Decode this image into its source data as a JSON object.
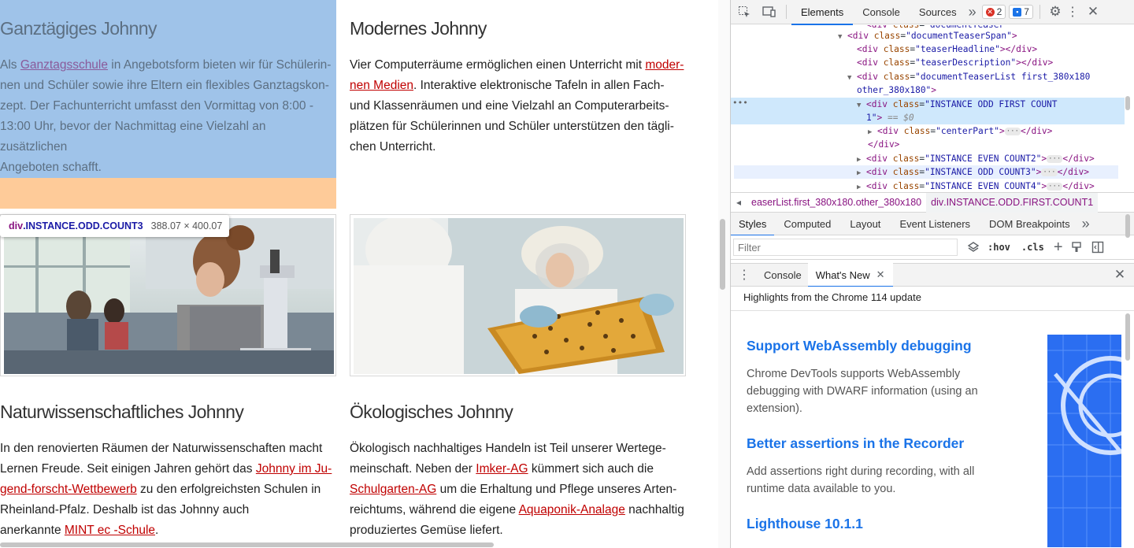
{
  "page": {
    "teasers": [
      {
        "headline": "Ganztägiges Johnny",
        "parts": [
          {
            "t": "Als "
          },
          {
            "a": "Ganztagsschule"
          },
          {
            "t": " in Angebotsform bieten wir für Schülerin-"
          },
          {
            "br": 1
          },
          {
            "t": "nen und Schüler sowie ihre Eltern ein flexibles Ganztagskon-"
          },
          {
            "br": 1
          },
          {
            "t": "zept. Der Fachunterricht umfasst den Vormittag von 8:00 -"
          },
          {
            "br": 1
          },
          {
            "t": "13:00 Uhr, bevor der Nachmittag eine Vielzahl an zusätzlichen"
          },
          {
            "br": 1
          },
          {
            "t": "Angeboten schafft."
          }
        ]
      },
      {
        "headline": "Modernes Johnny",
        "parts": [
          {
            "t": "Vier Computerräume ermöglichen einen Unterricht mit "
          },
          {
            "a": "moder-"
          },
          {
            "br": 1
          },
          {
            "a": "nen Medien"
          },
          {
            "t": ". Interaktive elektronische Tafeln in allen Fach-"
          },
          {
            "br": 1
          },
          {
            "t": "und Klassenräumen und eine Vielzahl an Computerarbeits-"
          },
          {
            "br": 1
          },
          {
            "t": "plätzen für Schülerinnen und Schüler unterstützen den tägli-"
          },
          {
            "br": 1
          },
          {
            "t": "chen Unterricht."
          }
        ]
      },
      {
        "headline": "Naturwissenschaftliches Johnny",
        "parts": [
          {
            "t": "In den renovierten Räumen der Naturwissenschaften macht"
          },
          {
            "br": 1
          },
          {
            "t": "Lernen Freude. Seit einigen Jahren gehört das "
          },
          {
            "a": "Johnny im Ju-"
          },
          {
            "br": 1
          },
          {
            "a": "gend-forscht-Wettbewerb"
          },
          {
            "t": " zu den erfolgreichsten Schulen in"
          },
          {
            "br": 1
          },
          {
            "t": "Rheinland-Pfalz. Deshalb ist das Johnny auch"
          },
          {
            "br": 1
          },
          {
            "t": "anerkannte "
          },
          {
            "a": "MINT ec -Schule"
          },
          {
            "t": "."
          }
        ]
      },
      {
        "headline": "Ökologisches Johnny",
        "parts": [
          {
            "t": "Ökologisch nachhaltiges Handeln ist Teil unserer Wertege-"
          },
          {
            "br": 1
          },
          {
            "t": "meinschaft. Neben der "
          },
          {
            "a": "Imker-AG"
          },
          {
            "t": " kümmert sich auch die"
          },
          {
            "br": 1
          },
          {
            "a": "Schulgarten-AG"
          },
          {
            "t": " um die Erhaltung und Pflege unseres Arten-"
          },
          {
            "br": 1
          },
          {
            "t": "reichtums, während die eigene "
          },
          {
            "a": "Aquaponik-Analage"
          },
          {
            "t": " nachhaltig"
          },
          {
            "br": 1
          },
          {
            "t": "produziertes Gemüse liefert."
          }
        ]
      }
    ],
    "tooltip": {
      "tag": "div",
      "classes": ".INSTANCE.ODD.COUNT3",
      "size": "388.07 × 400.07"
    }
  },
  "devtools": {
    "tabs": [
      "Elements",
      "Console",
      "Sources"
    ],
    "more": "»",
    "errors": "2",
    "messages": "7",
    "dom_lines": [
      {
        "html": "<span class='tg'>&lt;div</span> <span class='an'>class</span>=<span class='av'>\"documentTeaser\"</span>"
      },
      {
        "html": "<span class='tri'>▼</span><span class='tg'>&lt;div</span> <span class='an'>class</span>=<span class='av'>\"documentTeaserSpan\"</span><span class='tg'>&gt;</span>"
      },
      {
        "html": "<span class='tg'>&lt;div</span> <span class='an'>class</span>=<span class='av'>\"teaserHeadline\"</span><span class='tg'>&gt;&lt;/div&gt;</span>"
      },
      {
        "html": "<span class='tg'>&lt;div</span> <span class='an'>class</span>=<span class='av'>\"teaserDescription\"</span><span class='tg'>&gt;&lt;/div&gt;</span>"
      },
      {
        "html": "<span class='tri'>▼</span><span class='tg'>&lt;div</span> <span class='an'>class</span>=<span class='av'>\"documentTeaserList  first_380x180</span>"
      },
      {
        "html": "<span class='av'>other_380x180\"</span><span class='tg'>&gt;</span>"
      },
      {
        "html": "<span class='tri'>▼</span><span class='tg'>&lt;div</span> <span class='an'>class</span>=<span class='av'>\"INSTANCE ODD FIRST COUNT</span>"
      },
      {
        "html": "<span class='av'>1\"</span><span class='tg'>&gt;</span> <span class='eq'>== $0</span>"
      },
      {
        "html": "<span class='tri'>▶</span><span class='tg'>&lt;div</span> <span class='an'>class</span>=<span class='av'>\"centerPart\"</span><span class='tg'>&gt;</span><span class='ell'>···</span><span class='tg'>&lt;/div&gt;</span>"
      },
      {
        "html": "<span class='tg'>&lt;/div&gt;</span>"
      },
      {
        "html": "<span class='tri'>▶</span><span class='tg'>&lt;div</span> <span class='an'>class</span>=<span class='av'>\"INSTANCE EVEN COUNT2\"</span><span class='tg'>&gt;</span><span class='ell'>···</span><span class='tg'>&lt;/div&gt;</span>"
      },
      {
        "html": "<span class='tri'>▶</span><span class='tg'>&lt;div</span> <span class='an'>class</span>=<span class='av'>\"INSTANCE ODD COUNT3\"</span><span class='tg'>&gt;</span><span class='ell'>···</span><span class='tg'>&lt;/div&gt;</span>"
      },
      {
        "html": "<span class='tri'>▶</span><span class='tg'>&lt;div</span> <span class='an'>class</span>=<span class='av'>\"INSTANCE EVEN COUNT4\"</span><span class='tg'>&gt;</span><span class='ell'>···</span><span class='tg'>&lt;/div&gt;</span>"
      }
    ],
    "crumb_left": "◂",
    "crumbs": [
      {
        "text": "easerList.first_380x180.other_380x180",
        "tag": "",
        "active": false
      },
      {
        "text": ".INSTANCE.ODD.FIRST.COUNT1",
        "tag": "div",
        "active": true
      }
    ],
    "style_tabs": [
      "Styles",
      "Computed",
      "Layout",
      "Event Listeners",
      "DOM Breakpoints"
    ],
    "filter_placeholder": "Filter",
    "hov": ":hov",
    "cls": ".cls",
    "drawer_tabs": [
      "Console",
      "What's New"
    ],
    "whatsnew_head": "Highlights from the Chrome 114 update",
    "items": [
      {
        "title": "Support WebAssembly debugging",
        "body": "Chrome DevTools supports WebAssembly debugging with DWARF information (using an extension)."
      },
      {
        "title": "Better assertions in the Recorder",
        "body": "Add assertions right during recording, with all runtime data available to you."
      },
      {
        "title": "Lighthouse 10.1.1",
        "body": ""
      }
    ]
  }
}
